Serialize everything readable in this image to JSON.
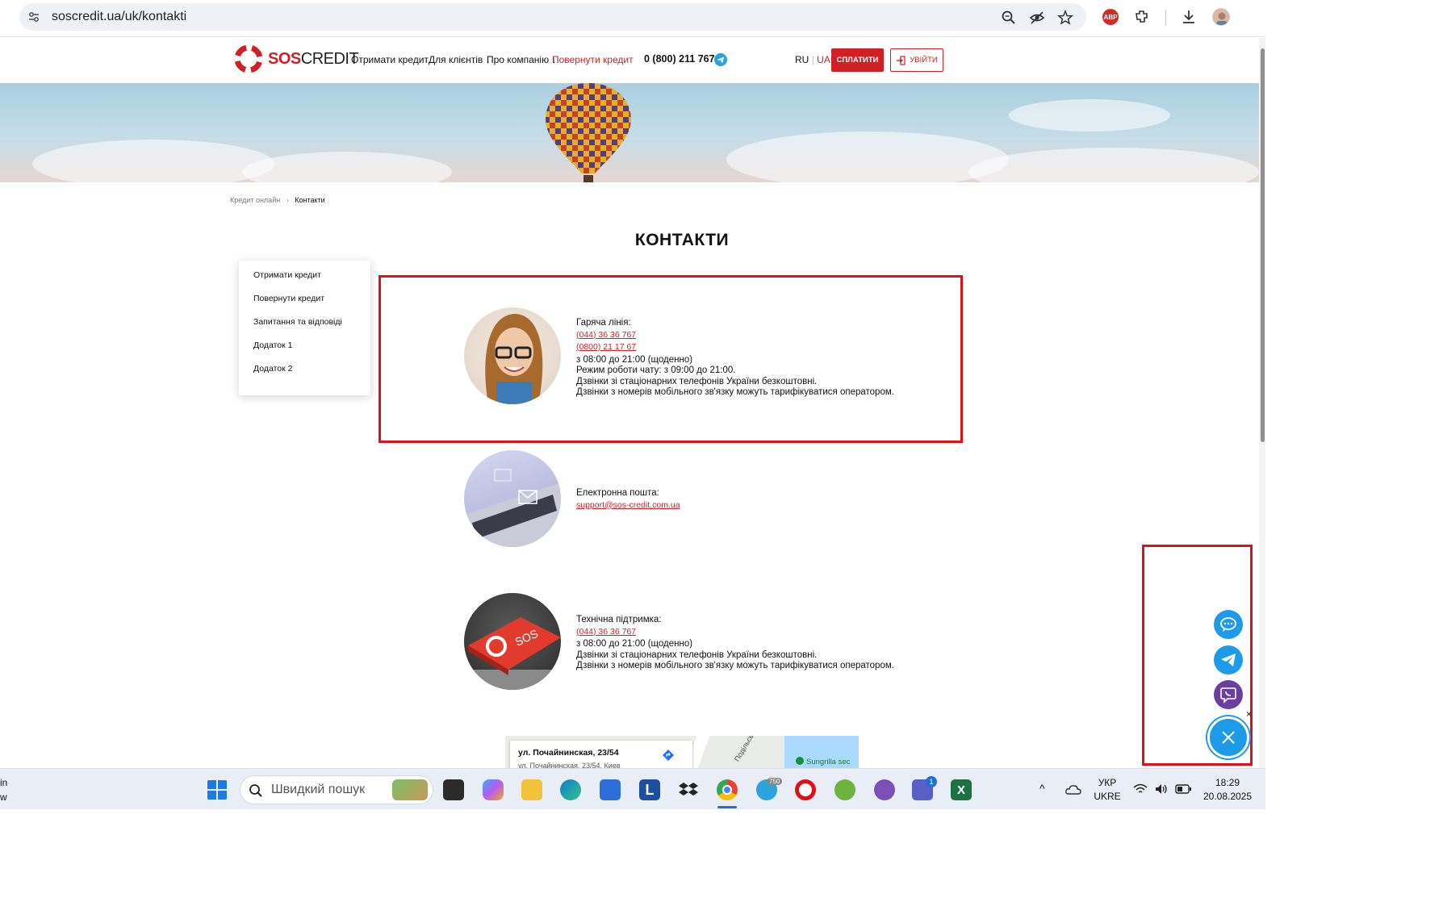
{
  "browser": {
    "url": "soscredit.ua/uk/kontakti",
    "abp_label": "ABP"
  },
  "header": {
    "logo_sos": "SOS",
    "logo_credit": "CREDIT",
    "nav": {
      "get_credit": "Отримати кредит",
      "for_clients": "Для клієнтів",
      "about": "Про компанію",
      "return_credit": "Повернути кредит"
    },
    "phone": "0 (800) 211 767",
    "lang_ru": "RU",
    "lang_ua": "UA",
    "pay_label": "СПЛАТИТИ",
    "login_label": "УВІЙТИ"
  },
  "breadcrumb": {
    "home": "Кредит онлайн",
    "current": "Контакти"
  },
  "page_title": "КОНТАКТИ",
  "side_menu": [
    "Отримати кредит",
    "Повернути кредит",
    "Запитання та відповіді",
    "Додаток 1",
    "Додаток 2"
  ],
  "contacts": {
    "hotline": {
      "title": "Гаряча лінія:",
      "phone1": "(044) 36 36 767",
      "phone2": "(0800) 21 17 67",
      "line1": "з 08:00 до 21:00 (щоденно)",
      "line2": "Режим роботи чату: з 09:00 до 21:00.",
      "line3": "Дзвінки зі стаціонарних телефонів України безкоштовні.",
      "line4": "Дзвінки з номерів мобільного зв'язку можуть тарифікуватися оператором."
    },
    "email": {
      "title": "Електронна пошта:",
      "address": "support@sos-credit.com.ua"
    },
    "support": {
      "title": "Технічна підтримка:",
      "phone": "(044) 36 36 767",
      "line1": "з 08:00 до 21:00 (щоденно)",
      "line2": "Дзвінки зі стаціонарних телефонів України безкоштовні.",
      "line3": "Дзвінки з номерів мобільного зв'язку можуть тарифікуватися оператором."
    },
    "sos_key_label": "SOS"
  },
  "map": {
    "address_title": "ул. Почайнинская, 23/54",
    "address_sub": "ул. Почайнинская, 23/54, Киев",
    "street_label": "Подільськ",
    "poi_label": "Sungrilla sec"
  },
  "taskbar": {
    "search_placeholder": "Швидкий пошук",
    "telegram_badge": "750",
    "teams_badge": "1",
    "lang_line1": "УКР",
    "lang_line2": "UKRE",
    "time": "18:29",
    "date": "20.08.2025",
    "left_text1": "in",
    "left_text2": "w"
  },
  "colors": {
    "brand_red": "#d11f26",
    "highlight_red": "#e10f1a",
    "fab_blue": "#1e9be8",
    "viber_purple": "#6b3fa0"
  }
}
